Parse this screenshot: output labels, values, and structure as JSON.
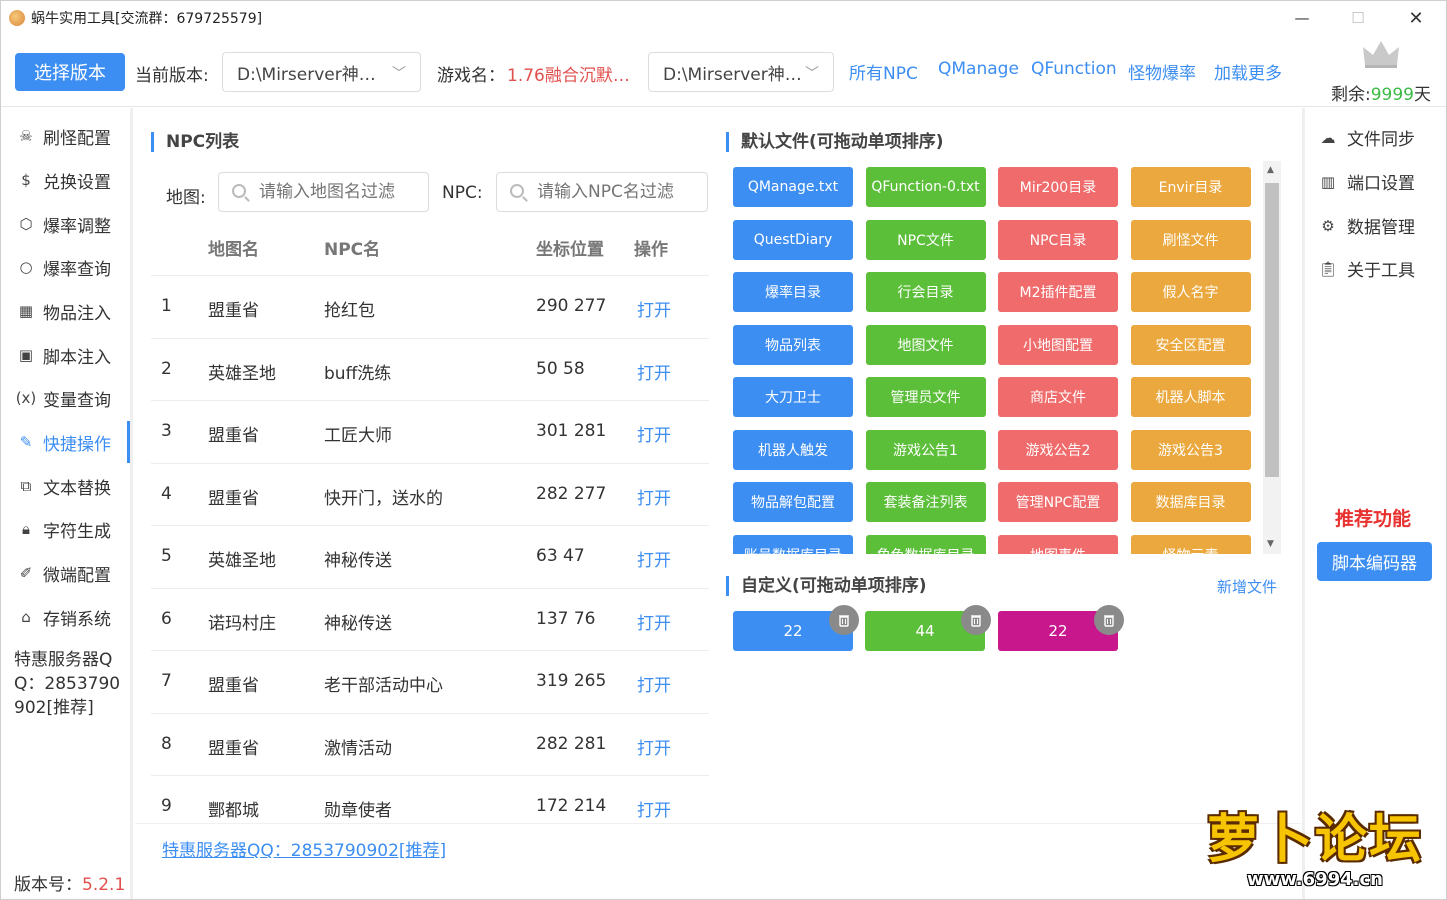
{
  "window": {
    "title": "蜗牛实用工具[交流群：679725579]",
    "min": "—",
    "max": "☐",
    "close": "✕"
  },
  "toolbar": {
    "select_version": "选择版本",
    "current_version_label": "当前版本:",
    "current_version_value": "D:\\Mirserver神…",
    "game_name_label": "游戏名：",
    "game_name_value": "1.76融合沉默…",
    "path_value": "D:\\Mirserver神…",
    "links": [
      "所有NPC",
      "QManage",
      "QFunction",
      "怪物爆率",
      "加载更多"
    ],
    "remain_label": "剩余:",
    "remain_value": "9999",
    "remain_unit": "天"
  },
  "sidebar": {
    "items": [
      {
        "label": "刷怪配置",
        "icon": "monster-icon"
      },
      {
        "label": "兑换设置",
        "icon": "dollar-icon"
      },
      {
        "label": "爆率调整",
        "icon": "cube-icon"
      },
      {
        "label": "爆率查询",
        "icon": "search-icon"
      },
      {
        "label": "物品注入",
        "icon": "grid-icon"
      },
      {
        "label": "脚本注入",
        "icon": "terminal-icon"
      },
      {
        "label": "变量查询",
        "icon": "variable-icon"
      },
      {
        "label": "快捷操作",
        "icon": "edit-icon"
      },
      {
        "label": "文本替换",
        "icon": "replace-icon"
      },
      {
        "label": "字符生成",
        "icon": "lock-icon"
      },
      {
        "label": "微端配置",
        "icon": "pen-icon"
      },
      {
        "label": "存销系统",
        "icon": "shop-icon"
      }
    ],
    "promo": "特惠服务器QQ：2853790902[推荐]",
    "version_label": "版本号：",
    "version_value": "5.2.1"
  },
  "npc_panel": {
    "title": "NPC列表",
    "map_label": "地图:",
    "map_placeholder": "请输入地图名过滤",
    "npc_label": "NPC:",
    "npc_placeholder": "请输入NPC名过滤",
    "headers": [
      "地图名",
      "NPC名",
      "坐标位置",
      "操作"
    ],
    "rows": [
      {
        "idx": "1",
        "map": "盟重省",
        "npc": "抢红包",
        "pos": "290 277",
        "op": "打开"
      },
      {
        "idx": "2",
        "map": "英雄圣地",
        "npc": "buff洗练",
        "pos": "50 58",
        "op": "打开"
      },
      {
        "idx": "3",
        "map": "盟重省",
        "npc": "工匠大师",
        "pos": "301 281",
        "op": "打开"
      },
      {
        "idx": "4",
        "map": "盟重省",
        "npc": "快开门，送水的",
        "pos": "282 277",
        "op": "打开"
      },
      {
        "idx": "5",
        "map": "英雄圣地",
        "npc": "神秘传送",
        "pos": "63 47",
        "op": "打开"
      },
      {
        "idx": "6",
        "map": "诺玛村庄",
        "npc": "神秘传送",
        "pos": "137 76",
        "op": "打开"
      },
      {
        "idx": "7",
        "map": "盟重省",
        "npc": "老干部活动中心",
        "pos": "319 265",
        "op": "打开"
      },
      {
        "idx": "8",
        "map": "盟重省",
        "npc": "激情活动",
        "pos": "282 281",
        "op": "打开"
      },
      {
        "idx": "9",
        "map": "酆都城",
        "npc": "勋章使者",
        "pos": "172 214",
        "op": "打开"
      }
    ],
    "bottom_link": "特惠服务器QQ：2853790902[推荐]"
  },
  "default_files": {
    "title": "默认文件(可拖动单项排序)",
    "colors": {
      "blue": "#3d8ef2",
      "green": "#5cbf3a",
      "red": "#f06c6c",
      "orange": "#eba83e"
    },
    "buttons": [
      [
        "QManage.txt",
        "QFunction-0.txt",
        "Mir200目录",
        "Envir目录"
      ],
      [
        "QuestDiary",
        "NPC文件",
        "NPC目录",
        "刷怪文件"
      ],
      [
        "爆率目录",
        "行会目录",
        "M2插件配置",
        "假人名字"
      ],
      [
        "物品列表",
        "地图文件",
        "小地图配置",
        "安全区配置"
      ],
      [
        "大刀卫士",
        "管理员文件",
        "商店文件",
        "机器人脚本"
      ],
      [
        "机器人触发",
        "游戏公告1",
        "游戏公告2",
        "游戏公告3"
      ],
      [
        "物品解包配置",
        "套装备注列表",
        "管理NPC配置",
        "数据库目录"
      ],
      [
        "账号数据库目录",
        "角色数据库目录",
        "地图事件",
        "怪物元素"
      ]
    ]
  },
  "custom_files": {
    "title": "自定义(可拖动单项排序)",
    "add_label": "新增文件",
    "buttons": [
      {
        "label": "22",
        "color": "#3d8ef2"
      },
      {
        "label": "44",
        "color": "#5cbf3a"
      },
      {
        "label": "22",
        "color": "#c8168c"
      }
    ]
  },
  "right_sidebar": {
    "items": [
      {
        "label": "文件同步",
        "icon": "cloud-upload-icon"
      },
      {
        "label": "端口设置",
        "icon": "port-icon"
      },
      {
        "label": "数据管理",
        "icon": "gear-icon"
      },
      {
        "label": "关于工具",
        "icon": "clipboard-icon"
      }
    ],
    "recommend": "推荐功能",
    "editor_button": "脚本编码器"
  },
  "site_logo": {
    "main": "萝卜论坛",
    "url": "www.6994.cn"
  }
}
